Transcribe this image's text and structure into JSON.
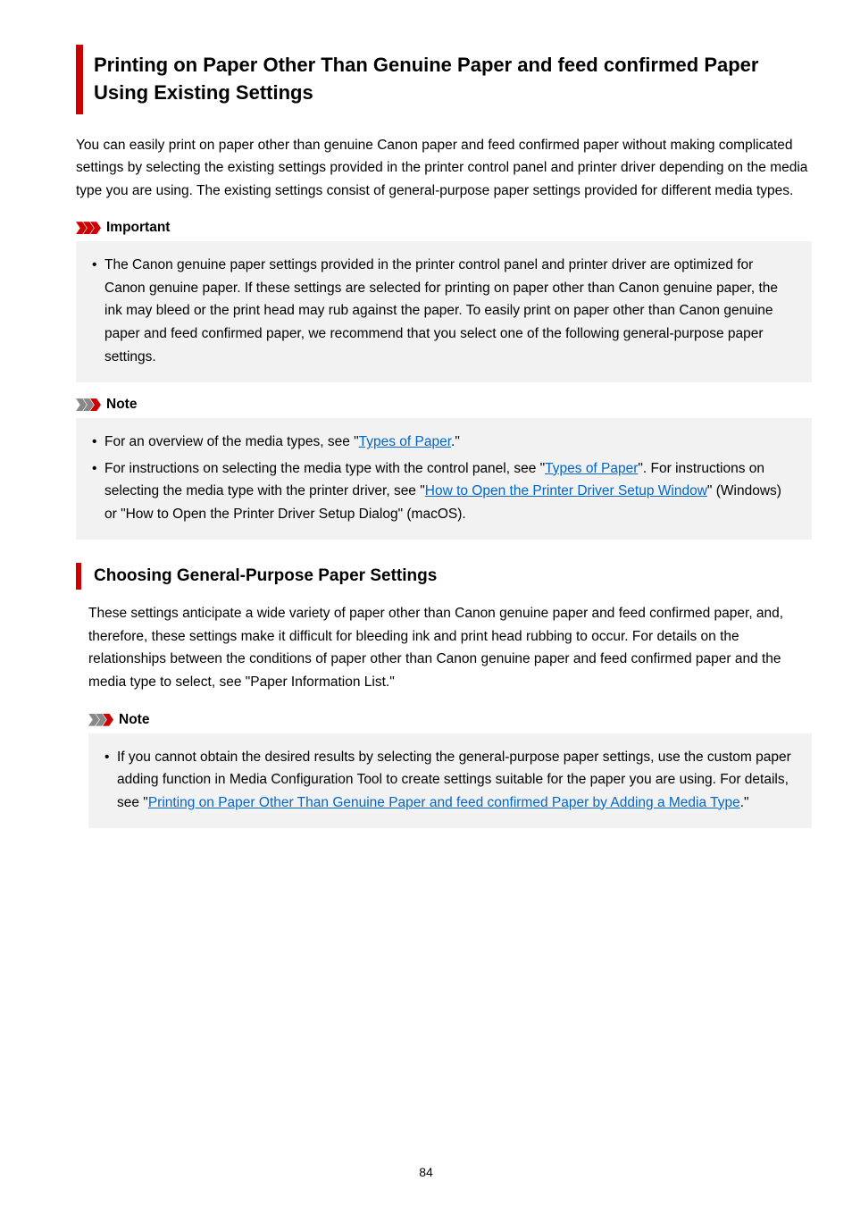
{
  "title": "Printing on Paper Other Than Genuine Paper and feed confirmed Paper Using Existing Settings",
  "intro": "You can easily print on paper other than genuine Canon paper and feed confirmed paper without making complicated settings by selecting the existing settings provided in the printer control panel and printer driver depending on the media type you are using. The existing settings consist of general-purpose paper settings provided for different media types.",
  "important": {
    "label": "Important",
    "items": [
      "The Canon genuine paper settings provided in the printer control panel and printer driver are optimized for Canon genuine paper. If these settings are selected for printing on paper other than Canon genuine paper, the ink may bleed or the print head may rub against the paper. To easily print on paper other than Canon genuine paper and feed confirmed paper, we recommend that you select one of the following general-purpose paper settings."
    ]
  },
  "note1": {
    "label": "Note",
    "item1_pre": "For an overview of the media types, see \"",
    "item1_link": "Types of Paper",
    "item1_post": ".\"",
    "item2_pre": "For instructions on selecting the media type with the control panel, see \"",
    "item2_link1": "Types of Paper",
    "item2_mid": "\". For instructions on selecting the media type with the printer driver, see \"",
    "item2_link2": "How to Open the Printer Driver Setup Window",
    "item2_post": "\" (Windows) or \"How to Open the Printer Driver Setup Dialog\" (macOS)."
  },
  "section": {
    "heading": "Choosing General-Purpose Paper Settings",
    "body": "These settings anticipate a wide variety of paper other than Canon genuine paper and feed confirmed paper, and, therefore, these settings make it difficult for bleeding ink and print head rubbing to occur. For details on the relationships between the conditions of paper other than Canon genuine paper and feed confirmed paper and the media type to select, see \"Paper Information List.\""
  },
  "note2": {
    "label": "Note",
    "item_pre": "If you cannot obtain the desired results by selecting the general-purpose paper settings, use the custom paper adding function in Media Configuration Tool to create settings suitable for the paper you are using. For details, see \"",
    "item_link": "Printing on Paper Other Than Genuine Paper and feed confirmed Paper by Adding a Media Type",
    "item_post": ".\""
  },
  "page_number": "84"
}
